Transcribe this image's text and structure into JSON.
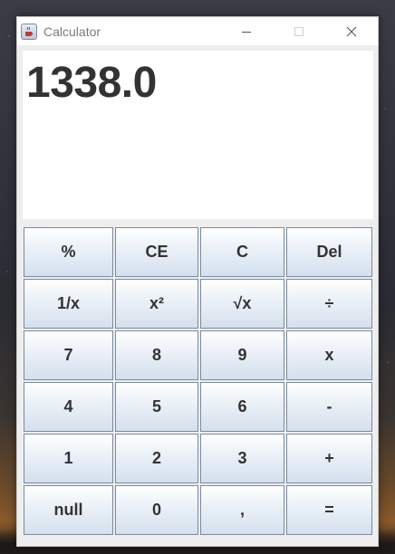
{
  "window": {
    "title": "Calculator",
    "icon": "java-cup-icon",
    "controls": [
      "minimize-icon",
      "maximize-icon",
      "close-icon"
    ]
  },
  "display": {
    "value": "1338.0"
  },
  "keypad": {
    "rows": [
      [
        "%",
        "CE",
        "C",
        "Del"
      ],
      [
        "1/x",
        "x²",
        "√x",
        "÷"
      ],
      [
        "7",
        "8",
        "9",
        "x"
      ],
      [
        "4",
        "5",
        "6",
        "-"
      ],
      [
        "1",
        "2",
        "3",
        "+"
      ],
      [
        "null",
        "0",
        ",",
        "="
      ]
    ]
  }
}
